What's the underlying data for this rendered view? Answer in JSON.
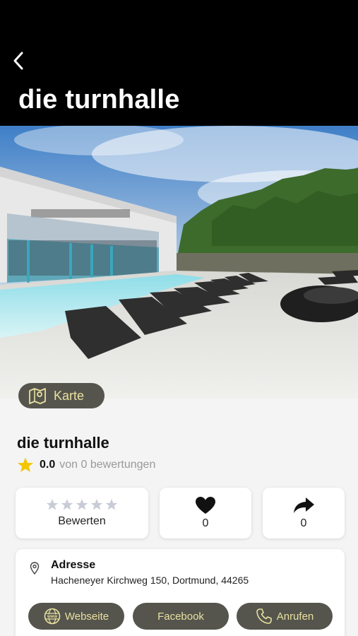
{
  "header": {
    "title": "die turnhalle",
    "back_icon": "chevron-left-icon"
  },
  "hero": {
    "map_button_label": "Karte",
    "map_icon": "map-pin-icon"
  },
  "venue": {
    "name": "die turnhalle",
    "rating": "0.0",
    "rating_suffix": "von 0 bewertungen"
  },
  "actions": {
    "rate_label": "Bewerten",
    "like_count": "0",
    "share_count": "0"
  },
  "address": {
    "title": "Adresse",
    "text": "Hacheneyer Kirchweg 150, Dortmund, 44265",
    "buttons": {
      "website": "Webseite",
      "facebook": "Facebook",
      "call": "Anrufen"
    }
  },
  "colors": {
    "header_bg": "#000000",
    "pill_bg": "#55554d",
    "pill_text": "#e8e0a0",
    "star_active": "#f2c500",
    "star_inactive": "#c9ccd6"
  }
}
